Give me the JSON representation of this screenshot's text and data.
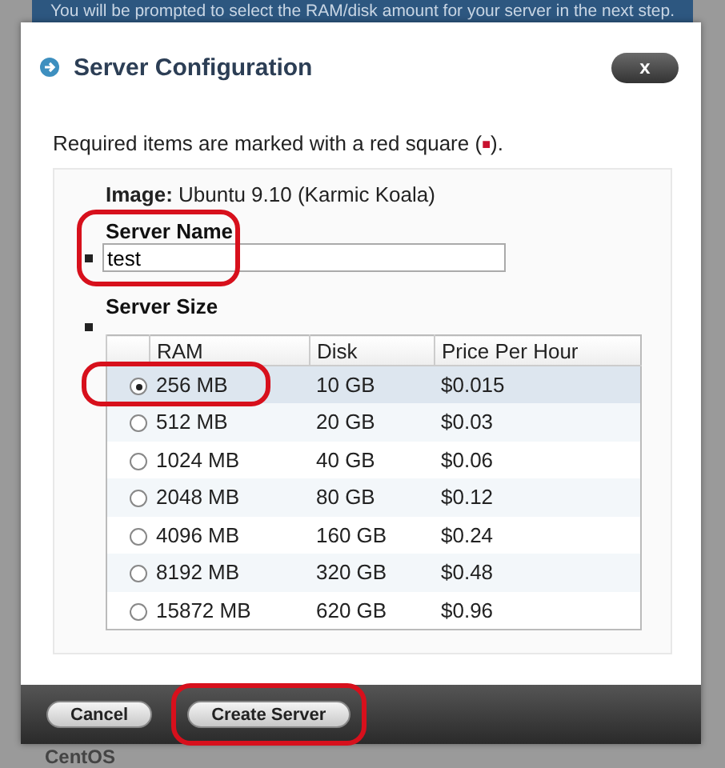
{
  "background": {
    "banner": "You will be prompted to select the RAM/disk amount for your server in the next step.",
    "logo": "CentOS"
  },
  "dialog": {
    "title": "Server Configuration",
    "close": "x",
    "note": {
      "before": "Required items are marked with a red square (",
      "mark": "■",
      "after": ")."
    },
    "image_line": "**Image:** Ubuntu 9.10 (Karmic Koala)",
    "server_name": {
      "label": "Server Name",
      "value": "test",
      "required": true,
      "highlighted": true
    },
    "server_size": {
      "label": "Server Size",
      "required": true,
      "columns": [
        "RAM",
        "Disk",
        "Price Per Hour"
      ],
      "rows": [
        {
          "ram": "256 MB",
          "disk": "10 GB",
          "price": "$0.015",
          "selected": true,
          "highlighted": true
        },
        {
          "ram": "512 MB",
          "disk": "20 GB",
          "price": "$0.03",
          "selected": false,
          "highlighted": false
        },
        {
          "ram": "1024 MB",
          "disk": "40 GB",
          "price": "$0.06",
          "selected": false,
          "highlighted": false
        },
        {
          "ram": "2048 MB",
          "disk": "80 GB",
          "price": "$0.12",
          "selected": false,
          "highlighted": false
        },
        {
          "ram": "4096 MB",
          "disk": "160 GB",
          "price": "$0.24",
          "selected": false,
          "highlighted": false
        },
        {
          "ram": "8192 MB",
          "disk": "320 GB",
          "price": "$0.48",
          "selected": false,
          "highlighted": false
        },
        {
          "ram": "15872 MB",
          "disk": "620 GB",
          "price": "$0.96",
          "selected": false,
          "highlighted": false
        }
      ]
    },
    "buttons": [
      {
        "label": "Cancel"
      },
      {
        "label": "Create Server",
        "highlighted": true
      }
    ]
  }
}
